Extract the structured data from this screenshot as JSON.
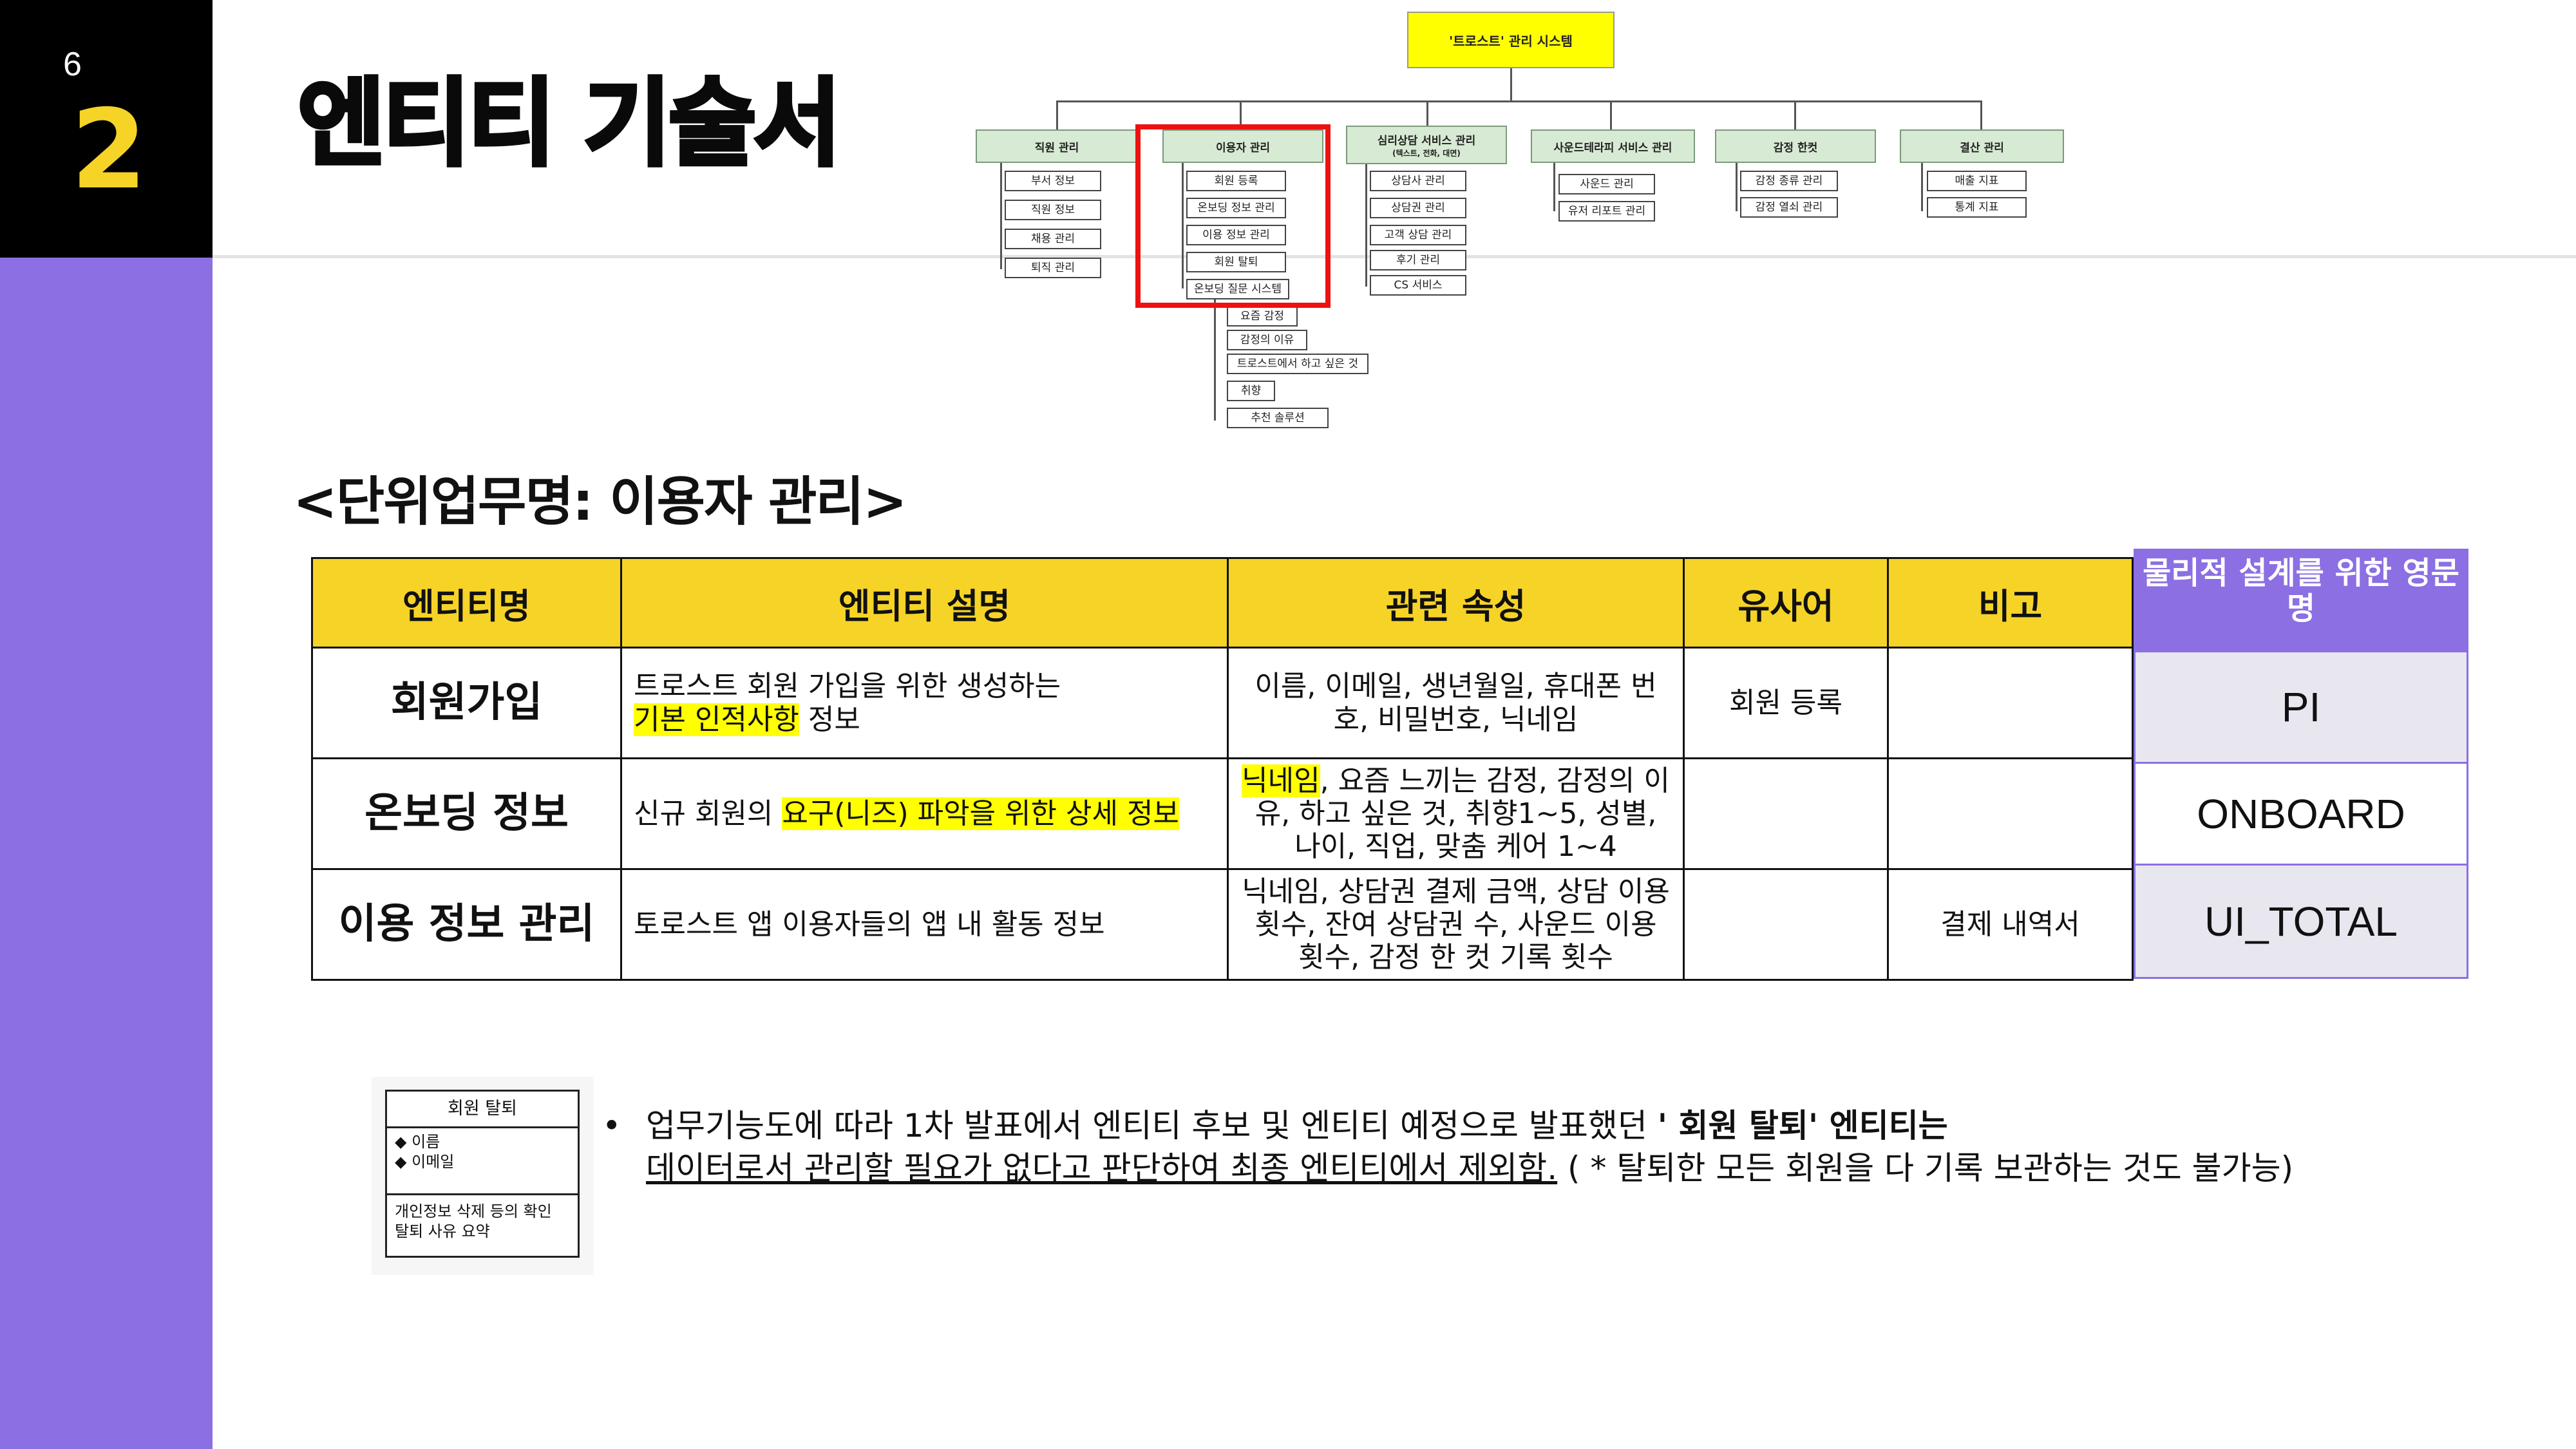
{
  "page": {
    "page_number": "6",
    "section_number": "2",
    "title": "엔티티 기술서",
    "subtitle": "<단위업무명: 이용자 관리>"
  },
  "org_chart": {
    "root": "'트로스트' 관리 시스템",
    "groups": [
      {
        "label": "직원 관리",
        "sublabel": "",
        "items": [
          "부서 정보",
          "직원 정보",
          "채용 관리",
          "퇴직 관리"
        ]
      },
      {
        "label": "이용자 관리",
        "sublabel": "",
        "items": [
          "회원 등록",
          "온보딩 정보 관리",
          "이용 정보 관리",
          "회원 탈퇴",
          "온보딩 질문 시스템"
        ],
        "sub_items": [
          "요즘 감정",
          "감정의 이유",
          "트로스트에서 하고 싶은 것",
          "취향",
          "추천 솔루션"
        ]
      },
      {
        "label": "심리상담 서비스 관리",
        "sublabel": "(텍스트, 전화, 대면)",
        "items": [
          "상담사 관리",
          "상담권 관리",
          "고객 상담 관리",
          "후기 관리",
          "CS 서비스"
        ]
      },
      {
        "label": "사운드테라피 서비스 관리",
        "sublabel": "",
        "items": [
          "사운드 관리",
          "유저 리포트 관리"
        ]
      },
      {
        "label": "감정 한컷",
        "sublabel": "",
        "items": [
          "감정 종류 관리",
          "감정 열쇠 관리"
        ]
      },
      {
        "label": "결산 관리",
        "sublabel": "",
        "items": [
          "매출 지표",
          "통계 지표"
        ]
      }
    ]
  },
  "table": {
    "headers": [
      "엔티티명",
      "엔티티 설명",
      "관련 속성",
      "유사어",
      "비고"
    ],
    "physical_header": "물리적 설계를 위한 영문명",
    "rows": [
      {
        "name": "회원가입",
        "desc_pre": "트로스트 회원 가입을 위한 생성하는",
        "desc_hl": "기본 인적사항",
        "desc_post": "정보",
        "attr_hl": "",
        "attr": "이름, 이메일, 생년월일, 휴대폰 번호, 비밀번호, 닉네임",
        "synonym": "회원 등록",
        "note": "",
        "physical": "PI"
      },
      {
        "name": "온보딩 정보",
        "desc_pre": "신규 회원의",
        "desc_hl": "요구(니즈) 파악을 위한 상세 정보",
        "desc_post": "",
        "attr_hl": "닉네임",
        "attr": ", 요즘 느끼는 감정, 감정의 이유, 하고 싶은 것, 취향1~5, 성별, 나이, 직업, 맞춤 케어 1~4",
        "synonym": "",
        "note": "",
        "physical": "ONBOARD"
      },
      {
        "name": "이용 정보 관리",
        "desc_pre": "토로스트 앱 이용자들의 앱 내 활동 정보",
        "desc_hl": "",
        "desc_post": "",
        "attr_hl": "",
        "attr": "닉네임, 상담권 결제 금액, 상담 이용 횟수, 잔여 상담권 수, 사운드 이용 횟수, 감정 한 컷 기록 횟수",
        "synonym": "",
        "note": "결제 내역서",
        "physical": "UI_TOTAL"
      }
    ]
  },
  "withdraw_entity": {
    "title": "회원 탈퇴",
    "attributes": [
      "◆ 이름",
      "◆ 이메일"
    ],
    "desc_lines": [
      "개인정보 삭제 등의 확인",
      "탈퇴 사유 요약"
    ]
  },
  "note": {
    "bullet": "•",
    "line1_pre": "업무기능도에 따라 1차 발표에서 엔티티 후보 및 엔티티 예정으로 발표했던",
    "line1_bold": "' 회원 탈퇴' 엔티티는",
    "line2_underline": "데이터로서 관리할 필요가 없다고 판단하여 최종 엔티티에서 제외함.",
    "line2_post": " ( * 탈퇴한 모든 회원을 다 기록 보관하는 것도 불가능)"
  },
  "colors": {
    "accent_yellow": "#f6d327",
    "accent_purple": "#8b6fe3",
    "highlight": "#ffff00",
    "chart_green": "#d7ead3",
    "red_box": "#ee1111"
  }
}
